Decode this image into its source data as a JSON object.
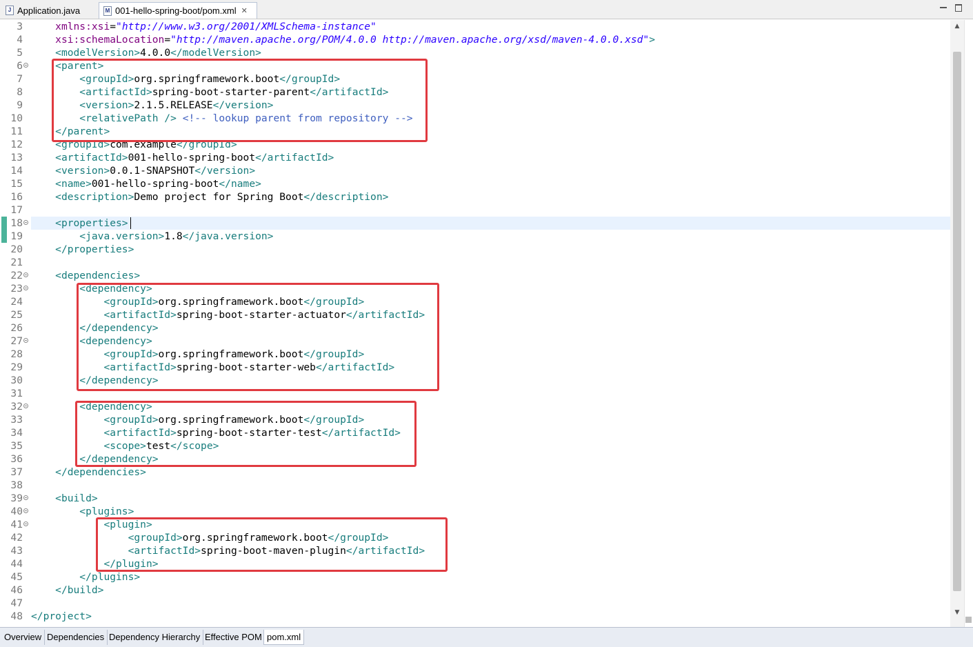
{
  "tabs": [
    {
      "label": "Application.java",
      "icon": "J"
    },
    {
      "label": "001-hello-spring-boot/pom.xml",
      "icon": "M"
    }
  ],
  "bottom_tabs": [
    "Overview",
    "Dependencies",
    "Dependency Hierarchy",
    "Effective POM",
    "pom.xml"
  ],
  "colors": {
    "tag": "#177c7c",
    "attribute": "#7f007f",
    "string": "#2a00ff",
    "comment": "#3f5fbf",
    "highlight_box": "#e03a40",
    "current_line": "#e8f2fe"
  },
  "lines": [
    {
      "n": "3",
      "tokens": [
        [
          "p",
          "    "
        ],
        [
          "a",
          "xmlns:xsi"
        ],
        [
          "p",
          "="
        ],
        [
          "s",
          "\"http://www.w3.org/2001/XMLSchema-instance\""
        ]
      ]
    },
    {
      "n": "4",
      "tokens": [
        [
          "p",
          "    "
        ],
        [
          "a",
          "xsi:schemaLocation"
        ],
        [
          "p",
          "="
        ],
        [
          "s",
          "\"http://maven.apache.org/POM/4.0.0 http://maven.apache.org/xsd/maven-4.0.0.xsd\""
        ],
        [
          "t",
          ">"
        ]
      ]
    },
    {
      "n": "5",
      "tokens": [
        [
          "p",
          "    "
        ],
        [
          "t",
          "<modelVersion>"
        ],
        [
          "x",
          "4.0.0"
        ],
        [
          "t",
          "</modelVersion>"
        ]
      ]
    },
    {
      "n": "6",
      "fold": true,
      "tokens": [
        [
          "p",
          "    "
        ],
        [
          "t",
          "<parent>"
        ]
      ]
    },
    {
      "n": "7",
      "tokens": [
        [
          "p",
          "        "
        ],
        [
          "t",
          "<groupId>"
        ],
        [
          "x",
          "org.springframework.boot"
        ],
        [
          "t",
          "</groupId>"
        ]
      ]
    },
    {
      "n": "8",
      "tokens": [
        [
          "p",
          "        "
        ],
        [
          "t",
          "<artifactId>"
        ],
        [
          "x",
          "spring-boot-starter-parent"
        ],
        [
          "t",
          "</artifactId>"
        ]
      ]
    },
    {
      "n": "9",
      "tokens": [
        [
          "p",
          "        "
        ],
        [
          "t",
          "<version>"
        ],
        [
          "x",
          "2.1.5.RELEASE"
        ],
        [
          "t",
          "</version>"
        ]
      ]
    },
    {
      "n": "10",
      "tokens": [
        [
          "p",
          "        "
        ],
        [
          "t",
          "<relativePath />"
        ],
        [
          "p",
          " "
        ],
        [
          "c",
          "<!-- lookup parent from repository -->"
        ]
      ]
    },
    {
      "n": "11",
      "tokens": [
        [
          "p",
          "    "
        ],
        [
          "t",
          "</parent>"
        ]
      ]
    },
    {
      "n": "12",
      "tokens": [
        [
          "p",
          "    "
        ],
        [
          "t",
          "<groupId>"
        ],
        [
          "x",
          "com.example"
        ],
        [
          "t",
          "</groupId>"
        ]
      ]
    },
    {
      "n": "13",
      "tokens": [
        [
          "p",
          "    "
        ],
        [
          "t",
          "<artifactId>"
        ],
        [
          "x",
          "001-hello-spring-boot"
        ],
        [
          "t",
          "</artifactId>"
        ]
      ]
    },
    {
      "n": "14",
      "tokens": [
        [
          "p",
          "    "
        ],
        [
          "t",
          "<version>"
        ],
        [
          "x",
          "0.0.1-SNAPSHOT"
        ],
        [
          "t",
          "</version>"
        ]
      ]
    },
    {
      "n": "15",
      "tokens": [
        [
          "p",
          "    "
        ],
        [
          "t",
          "<name>"
        ],
        [
          "x",
          "001-hello-spring-boot"
        ],
        [
          "t",
          "</name>"
        ]
      ]
    },
    {
      "n": "16",
      "tokens": [
        [
          "p",
          "    "
        ],
        [
          "t",
          "<description>"
        ],
        [
          "x",
          "Demo project for Spring Boot"
        ],
        [
          "t",
          "</description>"
        ]
      ]
    },
    {
      "n": "17",
      "tokens": []
    },
    {
      "n": "18",
      "fold": true,
      "current": true,
      "tokens": [
        [
          "p",
          "    "
        ],
        [
          "t",
          "<properties>"
        ]
      ]
    },
    {
      "n": "19",
      "tokens": [
        [
          "p",
          "        "
        ],
        [
          "t",
          "<java.version>"
        ],
        [
          "x",
          "1.8"
        ],
        [
          "t",
          "</java.version>"
        ]
      ]
    },
    {
      "n": "20",
      "tokens": [
        [
          "p",
          "    "
        ],
        [
          "t",
          "</properties>"
        ]
      ]
    },
    {
      "n": "21",
      "tokens": []
    },
    {
      "n": "22",
      "fold": true,
      "tokens": [
        [
          "p",
          "    "
        ],
        [
          "t",
          "<dependencies>"
        ]
      ]
    },
    {
      "n": "23",
      "fold": true,
      "tokens": [
        [
          "p",
          "        "
        ],
        [
          "t",
          "<dependency>"
        ]
      ]
    },
    {
      "n": "24",
      "tokens": [
        [
          "p",
          "            "
        ],
        [
          "t",
          "<groupId>"
        ],
        [
          "x",
          "org.springframework.boot"
        ],
        [
          "t",
          "</groupId>"
        ]
      ]
    },
    {
      "n": "25",
      "tokens": [
        [
          "p",
          "            "
        ],
        [
          "t",
          "<artifactId>"
        ],
        [
          "x",
          "spring-boot-starter-actuator"
        ],
        [
          "t",
          "</artifactId>"
        ]
      ]
    },
    {
      "n": "26",
      "tokens": [
        [
          "p",
          "        "
        ],
        [
          "t",
          "</dependency>"
        ]
      ]
    },
    {
      "n": "27",
      "fold": true,
      "tokens": [
        [
          "p",
          "        "
        ],
        [
          "t",
          "<dependency>"
        ]
      ]
    },
    {
      "n": "28",
      "tokens": [
        [
          "p",
          "            "
        ],
        [
          "t",
          "<groupId>"
        ],
        [
          "x",
          "org.springframework.boot"
        ],
        [
          "t",
          "</groupId>"
        ]
      ]
    },
    {
      "n": "29",
      "tokens": [
        [
          "p",
          "            "
        ],
        [
          "t",
          "<artifactId>"
        ],
        [
          "x",
          "spring-boot-starter-web"
        ],
        [
          "t",
          "</artifactId>"
        ]
      ]
    },
    {
      "n": "30",
      "tokens": [
        [
          "p",
          "        "
        ],
        [
          "t",
          "</dependency>"
        ]
      ]
    },
    {
      "n": "31",
      "tokens": []
    },
    {
      "n": "32",
      "fold": true,
      "tokens": [
        [
          "p",
          "        "
        ],
        [
          "t",
          "<dependency>"
        ]
      ]
    },
    {
      "n": "33",
      "tokens": [
        [
          "p",
          "            "
        ],
        [
          "t",
          "<groupId>"
        ],
        [
          "x",
          "org.springframework.boot"
        ],
        [
          "t",
          "</groupId>"
        ]
      ]
    },
    {
      "n": "34",
      "tokens": [
        [
          "p",
          "            "
        ],
        [
          "t",
          "<artifactId>"
        ],
        [
          "x",
          "spring-boot-starter-test"
        ],
        [
          "t",
          "</artifactId>"
        ]
      ]
    },
    {
      "n": "35",
      "tokens": [
        [
          "p",
          "            "
        ],
        [
          "t",
          "<scope>"
        ],
        [
          "x",
          "test"
        ],
        [
          "t",
          "</scope>"
        ]
      ]
    },
    {
      "n": "36",
      "tokens": [
        [
          "p",
          "        "
        ],
        [
          "t",
          "</dependency>"
        ]
      ]
    },
    {
      "n": "37",
      "tokens": [
        [
          "p",
          "    "
        ],
        [
          "t",
          "</dependencies>"
        ]
      ]
    },
    {
      "n": "38",
      "tokens": []
    },
    {
      "n": "39",
      "fold": true,
      "tokens": [
        [
          "p",
          "    "
        ],
        [
          "t",
          "<build>"
        ]
      ]
    },
    {
      "n": "40",
      "fold": true,
      "tokens": [
        [
          "p",
          "        "
        ],
        [
          "t",
          "<plugins>"
        ]
      ]
    },
    {
      "n": "41",
      "fold": true,
      "tokens": [
        [
          "p",
          "            "
        ],
        [
          "t",
          "<plugin>"
        ]
      ]
    },
    {
      "n": "42",
      "tokens": [
        [
          "p",
          "                "
        ],
        [
          "t",
          "<groupId>"
        ],
        [
          "x",
          "org.springframework.boot"
        ],
        [
          "t",
          "</groupId>"
        ]
      ]
    },
    {
      "n": "43",
      "tokens": [
        [
          "p",
          "                "
        ],
        [
          "t",
          "<artifactId>"
        ],
        [
          "x",
          "spring-boot-maven-plugin"
        ],
        [
          "t",
          "</artifactId>"
        ]
      ]
    },
    {
      "n": "44",
      "tokens": [
        [
          "p",
          "            "
        ],
        [
          "t",
          "</plugin>"
        ]
      ]
    },
    {
      "n": "45",
      "tokens": [
        [
          "p",
          "        "
        ],
        [
          "t",
          "</plugins>"
        ]
      ]
    },
    {
      "n": "46",
      "tokens": [
        [
          "p",
          "    "
        ],
        [
          "t",
          "</build>"
        ]
      ]
    },
    {
      "n": "47",
      "tokens": []
    },
    {
      "n": "48",
      "tokens": [
        [
          "t",
          "</project>"
        ]
      ]
    }
  ]
}
